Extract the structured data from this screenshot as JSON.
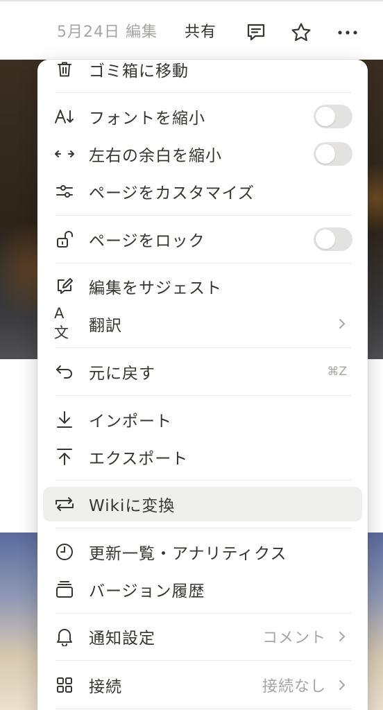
{
  "topbar": {
    "edited": "5月24日 編集",
    "share": "共有"
  },
  "colors": {
    "text": "#37352f",
    "muted": "#a6a5a2",
    "hover": "#efefee",
    "toggle_off": "#e3e2e0"
  },
  "menu": {
    "trash": "ゴミ箱に移動",
    "small_text": "フォントを縮小",
    "small_text_on": false,
    "full_width": "左右の余白を縮小",
    "full_width_on": false,
    "customize": "ページをカスタマイズ",
    "lock": "ページをロック",
    "lock_on": false,
    "suggest": "編集をサジェスト",
    "translate": "翻訳",
    "translate_icon": "A文",
    "undo": "元に戻す",
    "undo_shortcut": "⌘Z",
    "import": "インポート",
    "export": "エクスポート",
    "wiki": "Wikiに変換",
    "analytics": "更新一覧・アナリティクス",
    "version_history": "バージョン履歴",
    "notify": "通知設定",
    "notify_value": "コメント",
    "connections": "接続",
    "connections_value": "接続なし"
  },
  "icons": [
    "comment-icon",
    "star-icon",
    "more-icon",
    "trash-icon",
    "font-size-icon",
    "width-arrows-icon",
    "sliders-icon",
    "unlock-icon",
    "suggest-edit-icon",
    "translate-icon",
    "undo-icon",
    "import-icon",
    "export-icon",
    "convert-icon",
    "clock-icon",
    "versions-icon",
    "bell-icon",
    "grid-icon",
    "chevron-right-icon"
  ]
}
